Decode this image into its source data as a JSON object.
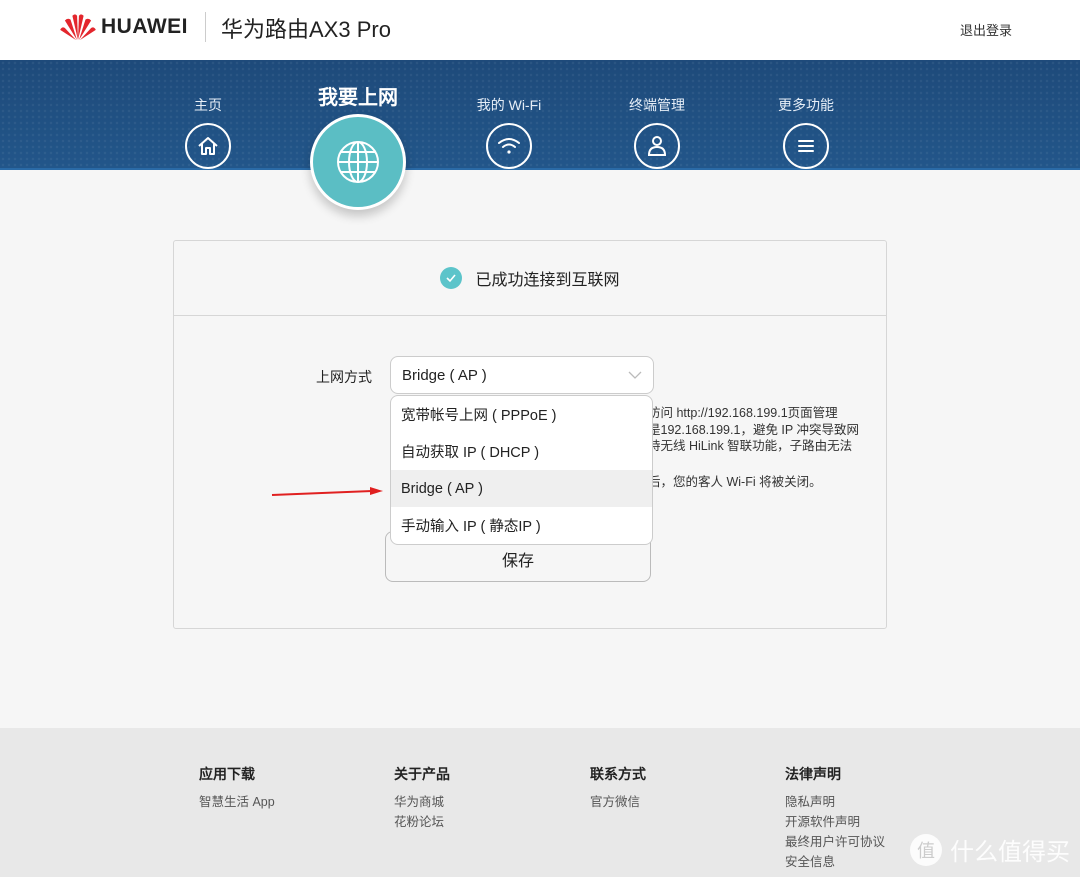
{
  "header": {
    "brand": "HUAWEI",
    "product_title": "华为路由AX3 Pro",
    "logout": "退出登录"
  },
  "nav": {
    "items": [
      {
        "label": "主页",
        "icon": "home-icon"
      },
      {
        "label": "我要上网",
        "icon": "globe-icon",
        "active": true
      },
      {
        "label": "我的 Wi-Fi",
        "icon": "wifi-icon"
      },
      {
        "label": "终端管理",
        "icon": "user-icon"
      },
      {
        "label": "更多功能",
        "icon": "menu-icon"
      }
    ]
  },
  "status": {
    "text": "已成功连接到互联网",
    "icon": "check-circle-icon",
    "color": "#5cc4ca"
  },
  "form": {
    "label": "上网方式",
    "selected": "Bridge ( AP )",
    "options": [
      "宽带帐号上网 ( PPPoE )",
      "自动获取 IP ( DHCP )",
      "Bridge ( AP )",
      "手动输入 IP ( 静态IP )"
    ],
    "highlighted_index": 2,
    "help_lines": [
      "访问 http://192.168.199.1页面管理",
      "是192.168.199.1，避免 IP 冲突导致网",
      "持无线 HiLink 智联功能，子路由无法",
      "后，您的客人 Wi-Fi 将被关闭。"
    ],
    "save_label": "保存"
  },
  "footer": {
    "columns": [
      {
        "title": "应用下载",
        "links": [
          "智慧生活 App"
        ]
      },
      {
        "title": "关于产品",
        "links": [
          "华为商城",
          "花粉论坛"
        ]
      },
      {
        "title": "联系方式",
        "links": [
          "官方微信"
        ]
      },
      {
        "title": "法律声明",
        "links": [
          "隐私声明",
          "开源软件声明",
          "最终用户许可协议",
          "安全信息"
        ]
      }
    ]
  },
  "watermark": {
    "glyph": "值",
    "text": "什么值得买"
  },
  "colors": {
    "banner": "#1e4a7a",
    "accent": "#5bbec4",
    "annotation_arrow": "#e02020"
  }
}
